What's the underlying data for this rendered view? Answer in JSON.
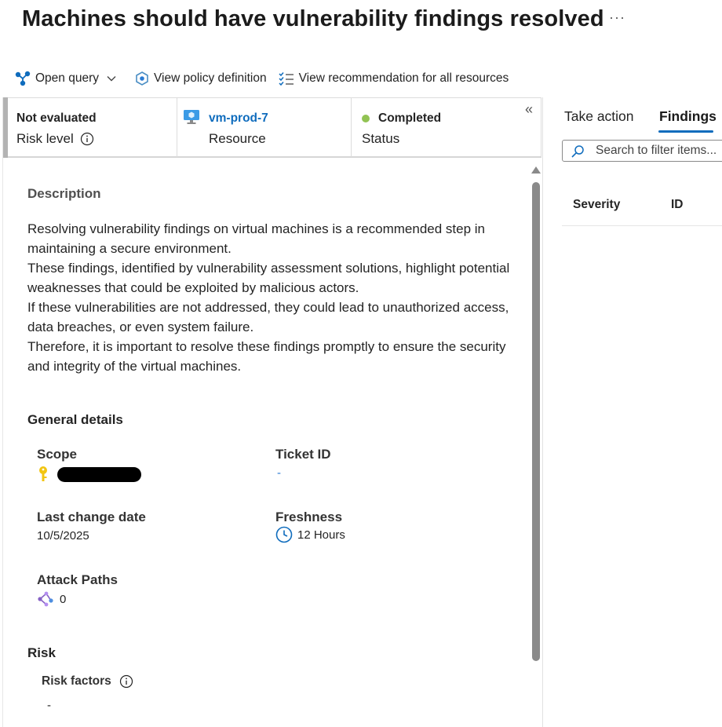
{
  "page": {
    "title": "Machines should have vulnerability findings resolved",
    "more_label": "···"
  },
  "toolbar": {
    "open_query": "Open query",
    "view_policy": "View policy definition",
    "view_recommendation": "View recommendation for all resources"
  },
  "summary": {
    "risk_value": "Not evaluated",
    "risk_label": "Risk level",
    "resource_value": "vm-prod-7",
    "resource_label": "Resource",
    "status_value": "Completed",
    "status_label": "Status",
    "status_color": "#92c353",
    "collapse_glyph": "«"
  },
  "description": {
    "heading": "Description",
    "paragraphs": [
      "Resolving vulnerability findings on virtual machines is a recommended step in maintaining a secure environment.",
      "These findings, identified by vulnerability assessment solutions, highlight potential weaknesses that could be exploited by malicious actors.",
      "If these vulnerabilities are not addressed, they could lead to unauthorized access, data breaches, or even system failure.",
      "Therefore, it is important to resolve these findings promptly to ensure the security and integrity of the virtual machines."
    ]
  },
  "general": {
    "heading": "General details",
    "scope_label": "Scope",
    "ticket_label": "Ticket ID",
    "ticket_value": "-",
    "last_change_label": "Last change date",
    "last_change_value": "10/5/2025",
    "freshness_label": "Freshness",
    "freshness_value": "12 Hours",
    "attack_label": "Attack Paths",
    "attack_value": "0"
  },
  "risk": {
    "heading": "Risk",
    "factors_label": "Risk factors",
    "factors_value": "-"
  },
  "right": {
    "tabs": [
      "Take action",
      "Findings"
    ],
    "active_tab": "Findings",
    "search_placeholder": "Search to filter items...",
    "columns": [
      "Severity",
      "ID"
    ]
  },
  "colors": {
    "link": "#0f6cbd",
    "accent": "#0f6cbd"
  }
}
